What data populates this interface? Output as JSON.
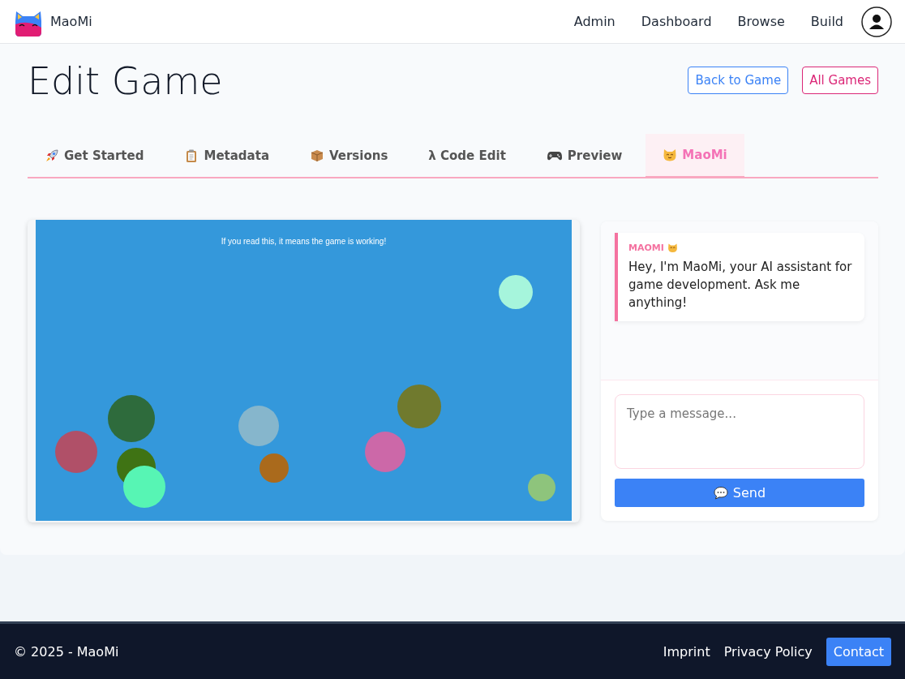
{
  "navbar": {
    "brand": "MaoMi",
    "links": [
      "Admin",
      "Dashboard",
      "Browse",
      "Build"
    ]
  },
  "page": {
    "title": "Edit Game",
    "actions": [
      {
        "label": "Back to Game",
        "kind": "primary"
      },
      {
        "label": "All Games",
        "kind": "secondary"
      }
    ]
  },
  "tabs": [
    {
      "label": "Get Started",
      "kind": "start",
      "selected": false
    },
    {
      "label": "Metadata",
      "kind": "metadata",
      "selected": false
    },
    {
      "label": "Versions",
      "kind": "versions",
      "selected": false
    },
    {
      "label": "λ Code Edit",
      "kind": "code",
      "selected": false
    },
    {
      "label": "Preview",
      "kind": "preview",
      "selected": false
    },
    {
      "label": "MaoMi",
      "kind": "assistant",
      "selected": true
    }
  ],
  "game_preview": {
    "text": "If you read this, it means the game is working!"
  },
  "chat": {
    "messages": [
      {
        "sender": "MAOMI",
        "text": "Hey, I'm MaoMi, your AI assistant for game development. Ask me anything!"
      }
    ],
    "input": {
      "placeholder": "Type a message..."
    },
    "send_button": "Send"
  },
  "footer": {
    "copyright": "© 2025 - MaoMi",
    "links": [
      {
        "label": "Imprint",
        "kind": "link"
      },
      {
        "label": "Privacy Policy",
        "kind": "link"
      },
      {
        "label": "Contact",
        "kind": "button"
      }
    ]
  }
}
